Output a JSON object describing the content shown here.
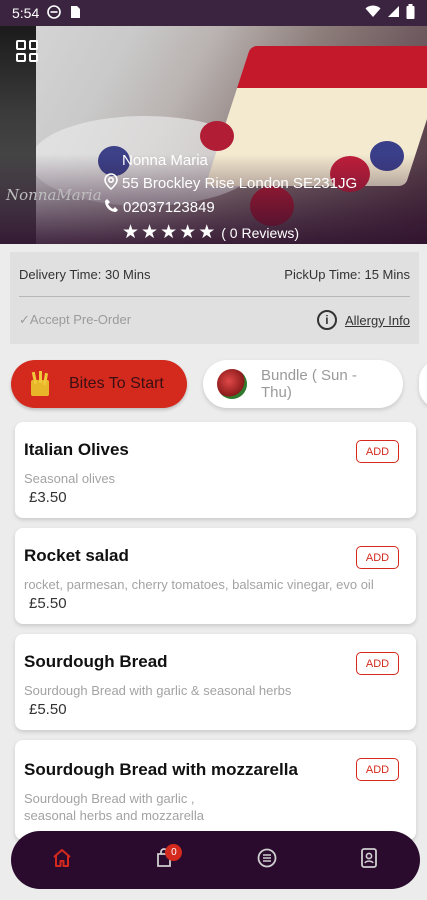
{
  "status_bar": {
    "time": "5:54"
  },
  "restaurant": {
    "name": "Nonna Maria",
    "address": "55 Brockley Rise London SE231JG",
    "phone": "02037123849",
    "rating_stars": 5,
    "reviews": "( 0 Reviews)",
    "logo_text": "NonnaMaria"
  },
  "info": {
    "delivery_time": "Delivery Time: 30 Mins",
    "pickup_time": "PickUp Time: 15 Mins",
    "pre_order": "✓Accept Pre-Order",
    "allergy_label": "Allergy Info"
  },
  "categories": [
    {
      "label": "Bites To Start",
      "active": true
    },
    {
      "label": "Bundle ( Sun - Thu)",
      "active": false
    }
  ],
  "menu_items": [
    {
      "title": "Italian Olives",
      "desc": "Seasonal olives",
      "price": "£3.50",
      "add": "ADD"
    },
    {
      "title": "Rocket salad",
      "desc": "rocket, parmesan, cherry tomatoes, balsamic vinegar, evo oil",
      "price": "£5.50",
      "add": "ADD"
    },
    {
      "title": "Sourdough Bread",
      "desc": "Sourdough Bread with garlic & seasonal herbs",
      "price": "£5.50",
      "add": "ADD"
    },
    {
      "title": "Sourdough Bread with mozzarella",
      "desc": "Sourdough Bread with garlic , seasonal herbs and mozzarella",
      "price": "",
      "add": "ADD"
    }
  ],
  "bottom_nav": {
    "cart_count": "0"
  },
  "colors": {
    "accent": "#d32a1d",
    "nav_bg": "#2a0b2e",
    "status_bg": "#3a2440"
  }
}
